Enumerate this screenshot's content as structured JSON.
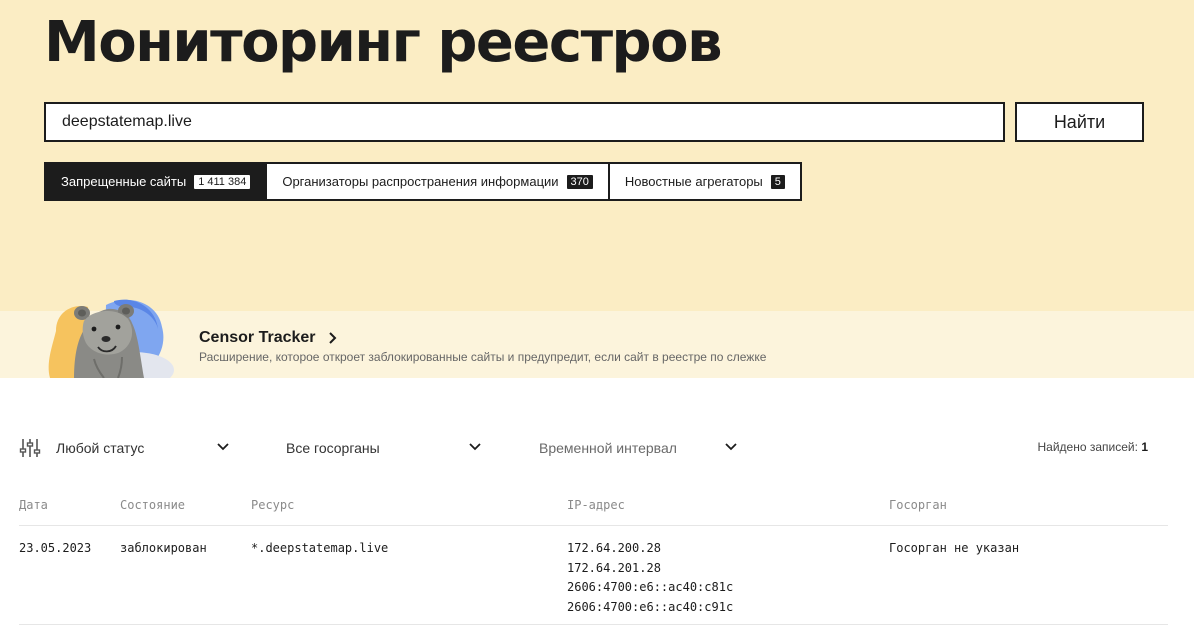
{
  "header": {
    "title": "Мониторинг реестров"
  },
  "search": {
    "value": "deepstatemap.live",
    "button_label": "Найти"
  },
  "tabs": [
    {
      "label": "Запрещенные сайты",
      "count": "1 411 384",
      "active": true
    },
    {
      "label": "Организаторы распространения информации",
      "count": "370",
      "active": false
    },
    {
      "label": "Новостные агрегаторы",
      "count": "5",
      "active": false
    }
  ],
  "promo": {
    "title": "Censor Tracker",
    "description": "Расширение, которое откроет заблокированные сайты и предупредит, если сайт в реестре по слежке",
    "icon": "chevron-right-icon"
  },
  "filters": {
    "icon": "sliders-icon",
    "status": "Любой статус",
    "agency": "Все госорганы",
    "interval": "Временной интервал"
  },
  "results": {
    "found_label": "Найдено записей:",
    "found_count": "1"
  },
  "table": {
    "columns": [
      "Дата",
      "Состояние",
      "Ресурс",
      "IP-адрес",
      "Госорган"
    ],
    "rows": [
      {
        "date": "23.05.2023",
        "status": "заблокирован",
        "resource": "*.deepstatemap.live",
        "ips": [
          "172.64.200.28",
          "172.64.201.28",
          "2606:4700:e6::ac40:c81c",
          "2606:4700:e6::ac40:c91c"
        ],
        "agency": "Госорган не указан"
      }
    ]
  },
  "colors": {
    "hero_bg": "#fbedc4",
    "promo_bg": "#fcf4dc",
    "ink": "#1c1c1c"
  }
}
